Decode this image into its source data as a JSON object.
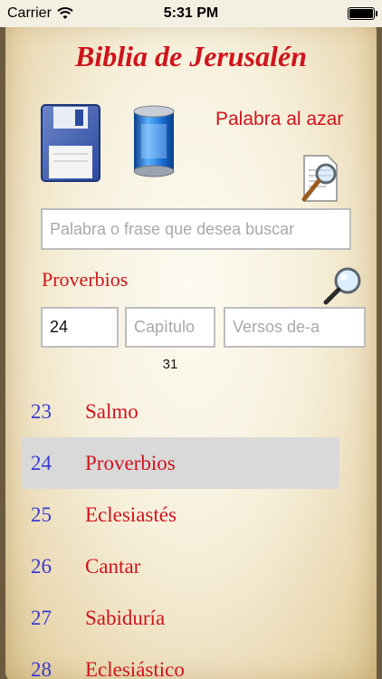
{
  "status": {
    "carrier": "Carrier",
    "time": "5:31 PM"
  },
  "app": {
    "title": "Biblia de Jerusalén"
  },
  "toolbar": {
    "save_icon": "floppy-disk-icon",
    "database_icon": "database-icon",
    "random_word_label": "Palabra al azar",
    "doc_search_icon": "document-search-icon"
  },
  "search": {
    "placeholder": "Palabra o frase que desea buscar",
    "value": ""
  },
  "selection": {
    "book_name": "Proverbios",
    "book_number": "24",
    "chapter_placeholder": "Capìtulo",
    "verses_placeholder": "Versos de-a",
    "chapter_count": "31"
  },
  "books": [
    {
      "num": "23",
      "name": "Salmo",
      "selected": false
    },
    {
      "num": "24",
      "name": "Proverbios",
      "selected": true
    },
    {
      "num": "25",
      "name": "Eclesiastés",
      "selected": false
    },
    {
      "num": "26",
      "name": "Cantar",
      "selected": false
    },
    {
      "num": "27",
      "name": "Sabiduría",
      "selected": false
    },
    {
      "num": "28",
      "name": "Eclesiástico",
      "selected": false
    }
  ],
  "colors": {
    "accent_red": "#d0141c",
    "number_blue": "#3a3ad0",
    "selected_row": "#d9d9d9"
  }
}
